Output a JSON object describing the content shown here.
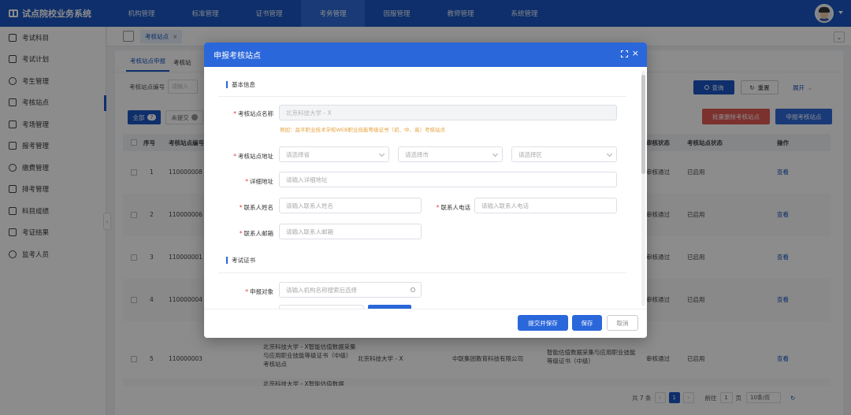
{
  "app": {
    "title": "试点院校业务系统"
  },
  "nav": [
    "机构管理",
    "标准管理",
    "证书管理",
    "考务管理",
    "固服管理",
    "教师管理",
    "系统管理"
  ],
  "sidebar": [
    "考试科目",
    "考试计划",
    "考生管理",
    "考核站点",
    "考场管理",
    "报考管理",
    "缴费管理",
    "排考管理",
    "科目成绩",
    "考证结果",
    "监考人员"
  ],
  "tabs": {
    "current": "考核站点",
    "close": "×"
  },
  "subtabs": [
    "考核站点申报",
    "考核站"
  ],
  "filter": {
    "label": "考核站点编号",
    "placeholder": "请输入"
  },
  "buttons": {
    "query": "查询",
    "reset": "重置",
    "expand": "展开",
    "batch_delete": "批量删除考核站点",
    "apply": "申报考核站点"
  },
  "chips": {
    "all": "全部",
    "all_count": "7",
    "not_submitted": "未提交"
  },
  "table": {
    "headers": [
      "序号",
      "考核站点编号",
      "审核状态",
      "考核站点状态",
      "操作"
    ],
    "rows": [
      {
        "no": "1",
        "code": "110000008",
        "audit": "审核通过",
        "status": "已启用",
        "op": "查看"
      },
      {
        "no": "2",
        "code": "110000006",
        "audit": "审核通过",
        "status": "已启用",
        "op": "查看"
      },
      {
        "no": "3",
        "code": "110000001",
        "audit": "审核通过",
        "status": "已启用",
        "op": "查看"
      },
      {
        "no": "4",
        "code": "110000004",
        "audit": "审核通过",
        "status": "已启用",
        "op": "查看"
      },
      {
        "no": "5",
        "code": "110000003",
        "audit": "审核通过",
        "status": "已启用",
        "op": "查看",
        "site_name": "北京科技大学 - X智能估值数据采集与应用职业技能等级证书（中级）考核站点",
        "school": "北京科技大学 - X",
        "org": "中联集团教育科技有限公司",
        "cert": "智能估值数据采集与应用职业技能等级证书（中级）"
      },
      {
        "partial": "北京科技大学 - X智能估值数据"
      }
    ]
  },
  "pager": {
    "total": "共 7 条",
    "page": "1",
    "goto": "前往",
    "goto_val": "1",
    "unit": "页",
    "size": "10条/页"
  },
  "modal": {
    "title": "申报考核站点",
    "section_basic": "基本信息",
    "section_cert": "考试证书",
    "fields": {
      "name_label": "考核站点名称",
      "name_value": "北京科技大学 - X",
      "name_hint": "例如：昌平职业技术学校WEB职业技能等级证书（初、中、高）考核站点",
      "addr_label": "考核站点地址",
      "province": "请选择省",
      "city": "请选择市",
      "district": "请选择区",
      "detail_label": "详细地址",
      "detail_ph": "请输入详细地址",
      "contact_label": "联系人姓名",
      "contact_ph": "请输入联系人姓名",
      "phone_label": "联系人电话",
      "phone_ph": "请输入联系人电话",
      "email_label": "联系人邮箱",
      "email_ph": "请输入联系人邮箱",
      "target_label": "申报对象",
      "target_ph": "请输入机构名称搜索后选择"
    },
    "footer": {
      "submit_save": "提交并保存",
      "save": "保存",
      "cancel": "取消"
    }
  },
  "colors": {
    "primary": "#2a67da",
    "danger": "#e05a55",
    "header": "#1a56c4"
  }
}
